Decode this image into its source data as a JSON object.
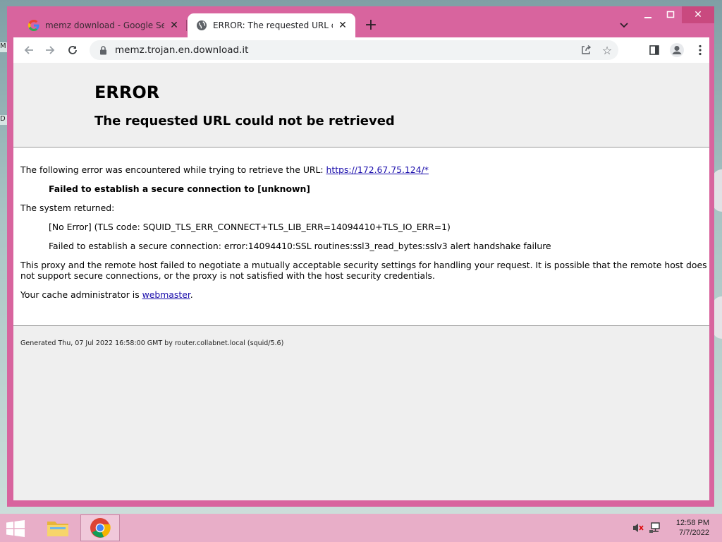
{
  "browser": {
    "tabs": [
      {
        "title": "memz download - Google Search",
        "favicon": "google-g-icon",
        "active": false
      },
      {
        "title": "ERROR: The requested URL could not be retrieved",
        "favicon": "globe-icon",
        "active": true
      }
    ],
    "new_tab_label": "+",
    "url": "memz.trojan.en.download.it"
  },
  "page": {
    "heading": "ERROR",
    "subheading": "The requested URL could not be retrieved",
    "intro_text": "The following error was encountered while trying to retrieve the URL: ",
    "intro_link": "https://172.67.75.124/*",
    "error_summary": "Failed to establish a secure connection to [unknown]",
    "system_returned": "The system returned:",
    "tls_code": "[No Error] (TLS code: SQUID_TLS_ERR_CONNECT+TLS_LIB_ERR=14094410+TLS_IO_ERR=1)",
    "ssl_error": "Failed to establish a secure connection: error:14094410:SSL routines:ssl3_read_bytes:sslv3 alert handshake failure",
    "explanation_line1": "This proxy and the remote host failed to negotiate a mutually acceptable security settings for handling your request. It is possible that the remote host does",
    "explanation_line2": "not support secure connections, or the proxy is not satisfied with the host security credentials.",
    "admin_prefix": "Your cache administrator is ",
    "admin_link": "webmaster",
    "admin_suffix": ".",
    "footer": "Generated Thu, 07 Jul 2022 16:58:00 GMT by router.collabnet.local (squid/5.6)"
  },
  "taskbar": {
    "time": "12:58 PM",
    "date": "7/7/2022"
  },
  "colors": {
    "window_frame": "#d8649e",
    "taskbar": "#e8aec8",
    "link": "#1a0dab"
  }
}
